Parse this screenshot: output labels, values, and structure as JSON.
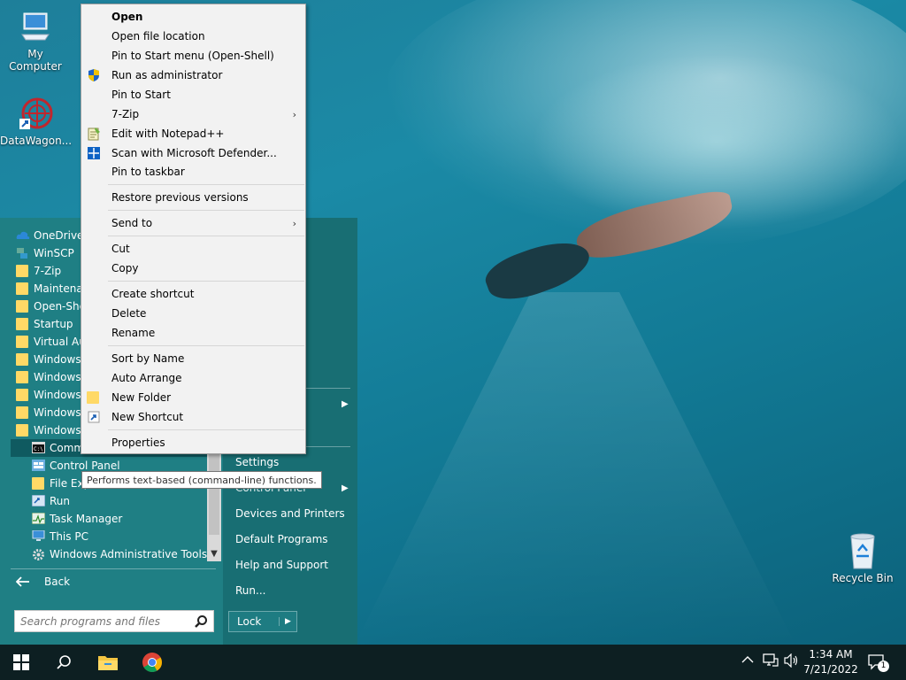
{
  "desktop": {
    "icons": [
      {
        "label": "My Computer"
      },
      {
        "label": "DataWagon..."
      },
      {
        "label": "Recycle Bin"
      }
    ]
  },
  "start_menu": {
    "programs": [
      {
        "label": "OneDrive",
        "icon": "cloud-icon"
      },
      {
        "label": "WinSCP",
        "icon": "winscp-icon"
      },
      {
        "label": "7-Zip",
        "icon": "folder-icon"
      },
      {
        "label": "Maintenan",
        "icon": "folder-icon"
      },
      {
        "label": "Open-She",
        "icon": "folder-icon"
      },
      {
        "label": "Startup",
        "icon": "folder-icon"
      },
      {
        "label": "Virtual Au",
        "icon": "folder-icon"
      },
      {
        "label": "Windows",
        "icon": "folder-icon"
      },
      {
        "label": "Windows",
        "icon": "folder-icon"
      },
      {
        "label": "Windows",
        "icon": "folder-icon"
      },
      {
        "label": "Windows",
        "icon": "folder-icon"
      },
      {
        "label": "Windows",
        "icon": "folder-icon"
      }
    ],
    "subitems": [
      {
        "label": "Comm",
        "icon": "command-prompt-icon"
      },
      {
        "label": "Control Panel",
        "icon": "control-panel-icon"
      },
      {
        "label": "File Exp",
        "icon": "file-explorer-icon"
      },
      {
        "label": "Run",
        "icon": "run-icon"
      },
      {
        "label": "Task Manager",
        "icon": "task-manager-icon"
      },
      {
        "label": "This PC",
        "icon": "this-pc-icon"
      },
      {
        "label": "Windows Administrative Tools",
        "icon": "admin-tools-icon"
      }
    ],
    "back_label": "Back",
    "search_placeholder": "Search programs and files",
    "right_items": [
      {
        "label": "Settings"
      },
      {
        "label": "Control Panel"
      },
      {
        "label": "Devices and Printers"
      },
      {
        "label": "Default Programs"
      },
      {
        "label": "Help and Support"
      },
      {
        "label": "Run..."
      }
    ],
    "lock_label": "Lock"
  },
  "context_menu": {
    "items": [
      {
        "label": "Open"
      },
      {
        "label": "Open file location"
      },
      {
        "label": "Pin to Start menu (Open-Shell)"
      },
      {
        "label": "Run as administrator",
        "icon": "uac-shield-icon"
      },
      {
        "label": "Pin to Start"
      },
      {
        "label": "7-Zip"
      },
      {
        "label": "Edit with Notepad++",
        "icon": "notepad-plus-plus-icon"
      },
      {
        "label": "Scan with Microsoft Defender...",
        "icon": "defender-icon"
      },
      {
        "label": "Pin to taskbar"
      },
      {
        "label": "Restore previous versions"
      },
      {
        "label": "Send to"
      },
      {
        "label": "Cut"
      },
      {
        "label": "Copy"
      },
      {
        "label": "Create shortcut"
      },
      {
        "label": "Delete"
      },
      {
        "label": "Rename"
      },
      {
        "label": "Sort by Name"
      },
      {
        "label": "Auto Arrange"
      },
      {
        "label": "New Folder",
        "icon": "folder-icon"
      },
      {
        "label": "New Shortcut",
        "icon": "shortcut-icon"
      },
      {
        "label": "Properties"
      }
    ]
  },
  "tooltip": "Performs text-based (command-line) functions.",
  "taskbar": {
    "time": "1:34 AM",
    "date": "7/21/2022",
    "notification_count": "1"
  }
}
